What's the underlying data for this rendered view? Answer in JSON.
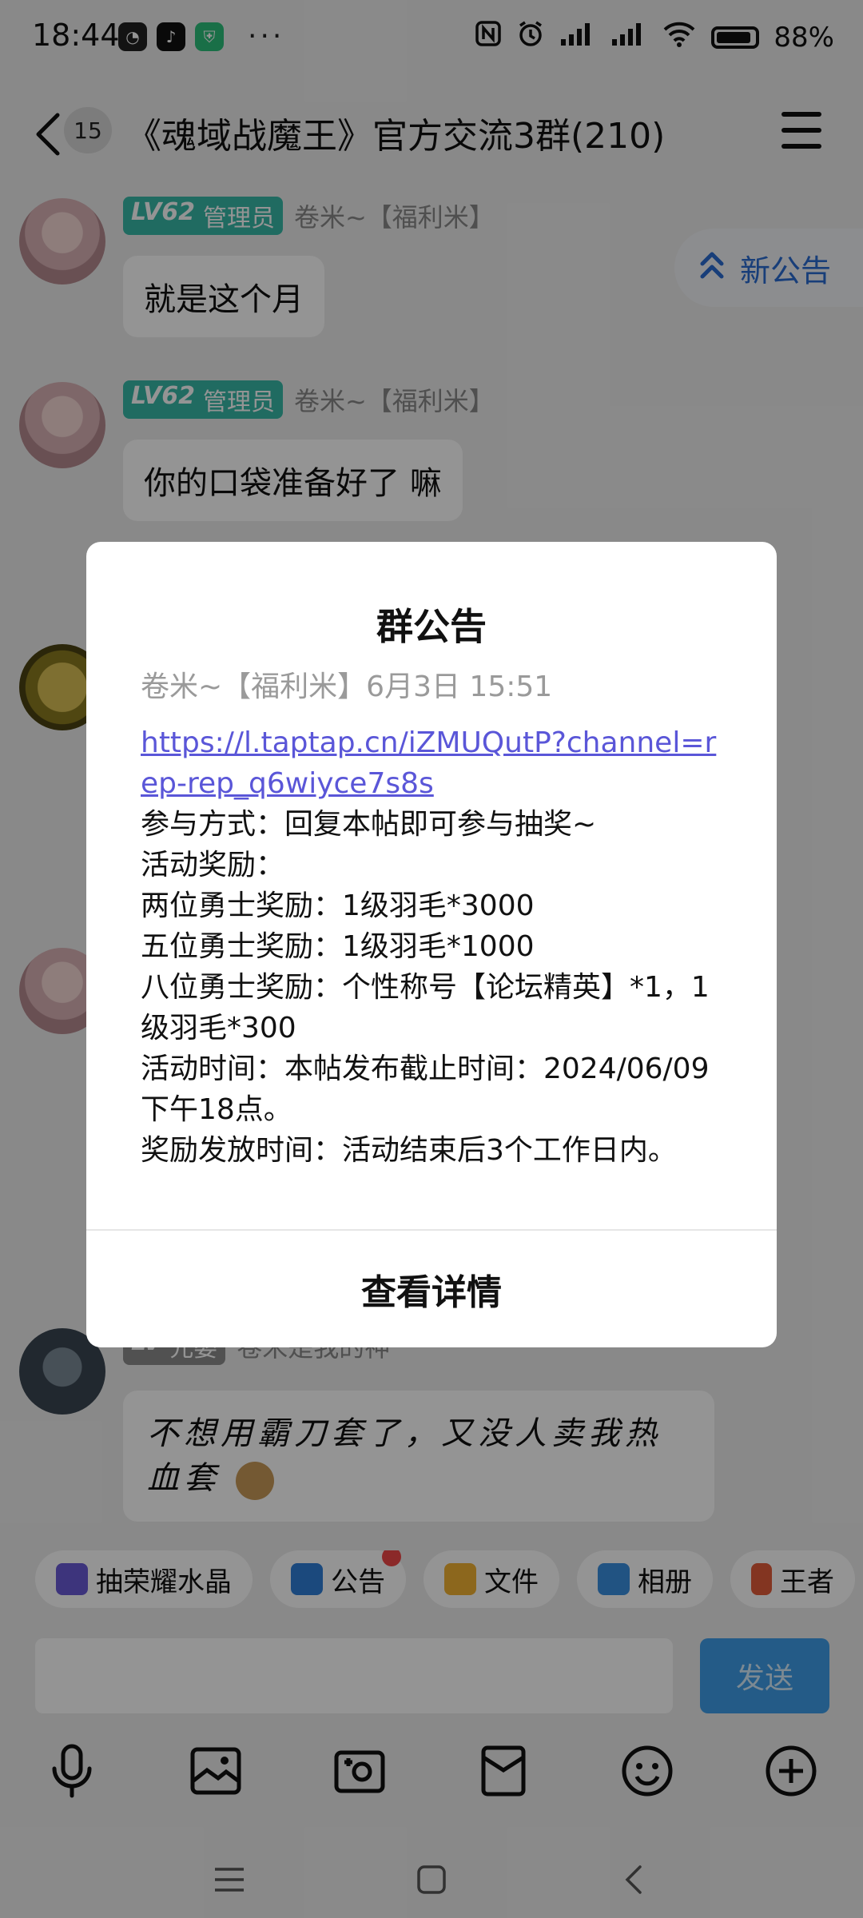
{
  "status_bar": {
    "time": "18:44",
    "dots": "···",
    "battery": "88%"
  },
  "header": {
    "unread_count": "15",
    "title": "《魂域战魔王》官方交流3群(210)"
  },
  "messages": [
    {
      "level": "LV62",
      "role": "管理员",
      "sender": "卷米~【福利米】",
      "text": "就是这个月"
    },
    {
      "level": "LV62",
      "role": "管理员",
      "sender": "卷米~【福利米】",
      "text": "你的口袋准备好了 嘛"
    },
    {
      "sender": "卷米是我的神",
      "text": "不想用霸刀套了，又没人卖我热血套"
    }
  ],
  "new_notice": {
    "label": "新公告"
  },
  "quick_bar": [
    {
      "label": "抽荣耀水晶",
      "icon": "crystal-icon"
    },
    {
      "label": "公告",
      "icon": "bag-icon",
      "dot": true
    },
    {
      "label": "文件",
      "icon": "folder-icon"
    },
    {
      "label": "相册",
      "icon": "album-icon"
    },
    {
      "label": "王者",
      "icon": "king-icon"
    }
  ],
  "input": {
    "send_label": "发送"
  },
  "modal": {
    "title": "群公告",
    "meta": "卷米~【福利米】6月3日 15:51",
    "link": "https://l.taptap.cn/iZMUQutP?channel=rep-rep_q6wiyce7s8s",
    "lines": [
      "参与方式：回复本帖即可参与抽奖~",
      "活动奖励：",
      "两位勇士奖励：1级羽毛*3000",
      "五位勇士奖励：1级羽毛*1000",
      "八位勇士奖励：个性称号【论坛精英】*1，1级羽毛*300",
      "活动时间：本帖发布截止时间：2024/06/09下午18点。",
      "奖励发放时间：活动结束后3个工作日内。"
    ],
    "button": "查看详情"
  },
  "colors": {
    "accent": "#2a6cd1",
    "badge": "#38b8a8",
    "send": "#3f9ee8",
    "link": "#5a56d8"
  }
}
